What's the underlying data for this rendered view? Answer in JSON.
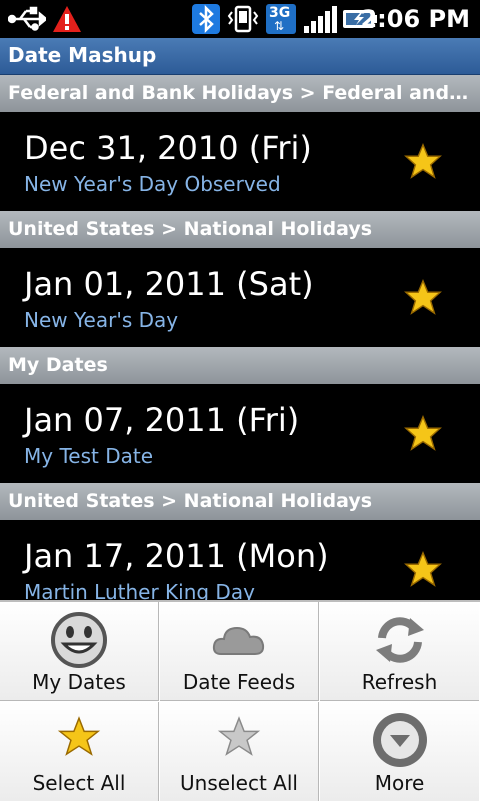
{
  "status_bar": {
    "time": "2:06 PM",
    "network_label": "3G",
    "icons": [
      "usb-icon",
      "warning-icon",
      "bluetooth-icon",
      "vibrate-icon",
      "3g-data-icon",
      "signal-icon",
      "battery-charging-icon"
    ]
  },
  "app": {
    "title": "Date Mashup"
  },
  "list": {
    "sections": [
      {
        "header": "Federal and Bank Holidays > Federal and Bank Holidays",
        "items": [
          {
            "date": "Dec 31, 2010 (Fri)",
            "name": "New Year's Day Observed",
            "starred": true
          }
        ]
      },
      {
        "header": "United States > National Holidays",
        "items": [
          {
            "date": "Jan 01, 2011 (Sat)",
            "name": "New Year's Day",
            "starred": true
          }
        ]
      },
      {
        "header": "My Dates",
        "items": [
          {
            "date": "Jan 07, 2011 (Fri)",
            "name": "My Test Date",
            "starred": true
          }
        ]
      },
      {
        "header": "United States > National Holidays",
        "items": [
          {
            "date": "Jan 17, 2011 (Mon)",
            "name": "Martin Luther King Day",
            "starred": true
          }
        ]
      }
    ]
  },
  "menu": {
    "items": [
      {
        "label": "My Dates",
        "icon": "smiley-face-icon"
      },
      {
        "label": "Date Feeds",
        "icon": "cloud-icon"
      },
      {
        "label": "Refresh",
        "icon": "refresh-icon"
      },
      {
        "label": "Select All",
        "icon": "gold-star-icon"
      },
      {
        "label": "Unselect All",
        "icon": "gray-star-icon"
      },
      {
        "label": "More",
        "icon": "more-arrow-icon"
      }
    ]
  },
  "colors": {
    "title_bar": "#3a6aa6",
    "section_header": "#a1a6ab",
    "subtitle_text": "#86b4e6",
    "star": "#f5c518"
  }
}
